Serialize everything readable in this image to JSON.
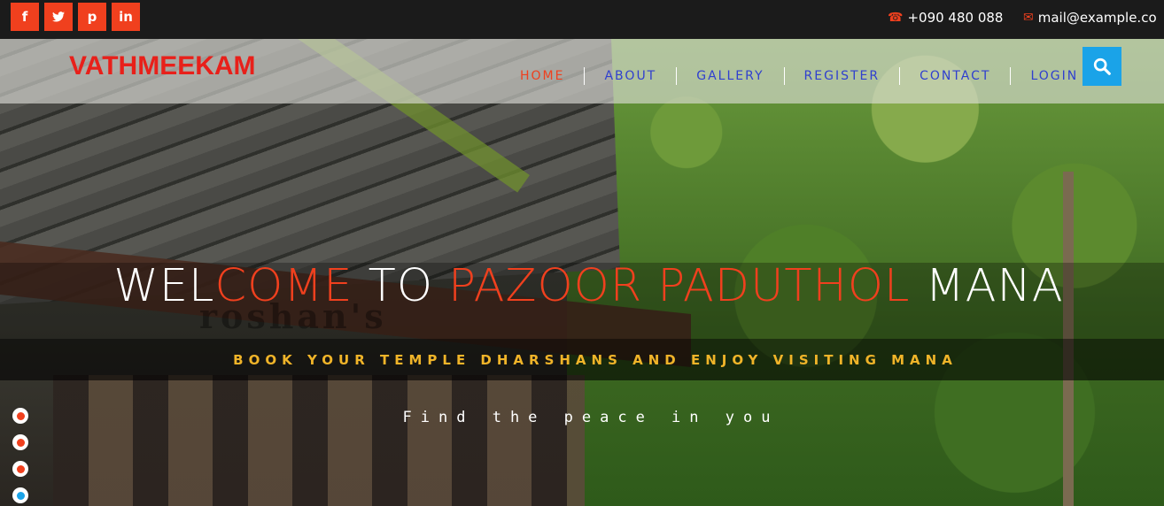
{
  "topbar": {
    "social": [
      {
        "label": "f",
        "icon": "facebook-icon"
      },
      {
        "label": "t",
        "icon": "twitter-icon"
      },
      {
        "label": "p",
        "icon": "pinterest-icon"
      },
      {
        "label": "in",
        "icon": "linkedin-icon"
      }
    ],
    "phone": "+090 480 088",
    "email": "mail@example.co"
  },
  "nav": {
    "brand": "VATHMEEKAM",
    "items": [
      "HOME",
      "ABOUT",
      "GALLERY",
      "REGISTER",
      "CONTACT",
      "LOGIN"
    ],
    "active": "HOME",
    "search_icon": "search-icon"
  },
  "hero": {
    "welcome_1": "WEL",
    "welcome_2": "COME",
    "welcome_3": " TO ",
    "welcome_4": "PAZOOR PADUTHOL",
    "welcome_5": " MANA",
    "ghost": "roshan's",
    "tagline": "BOOK YOUR TEMPLE DHARSHANS AND ENJOY VISITING MANA",
    "sub": "Find the peace in you",
    "slides": 4,
    "active_slide": 4
  },
  "colors": {
    "accent": "#f0401e",
    "brand": "#e8201a",
    "nav_link": "#2f3fcf",
    "search_bg": "#1aa3e8",
    "tagline": "#f0b429"
  }
}
